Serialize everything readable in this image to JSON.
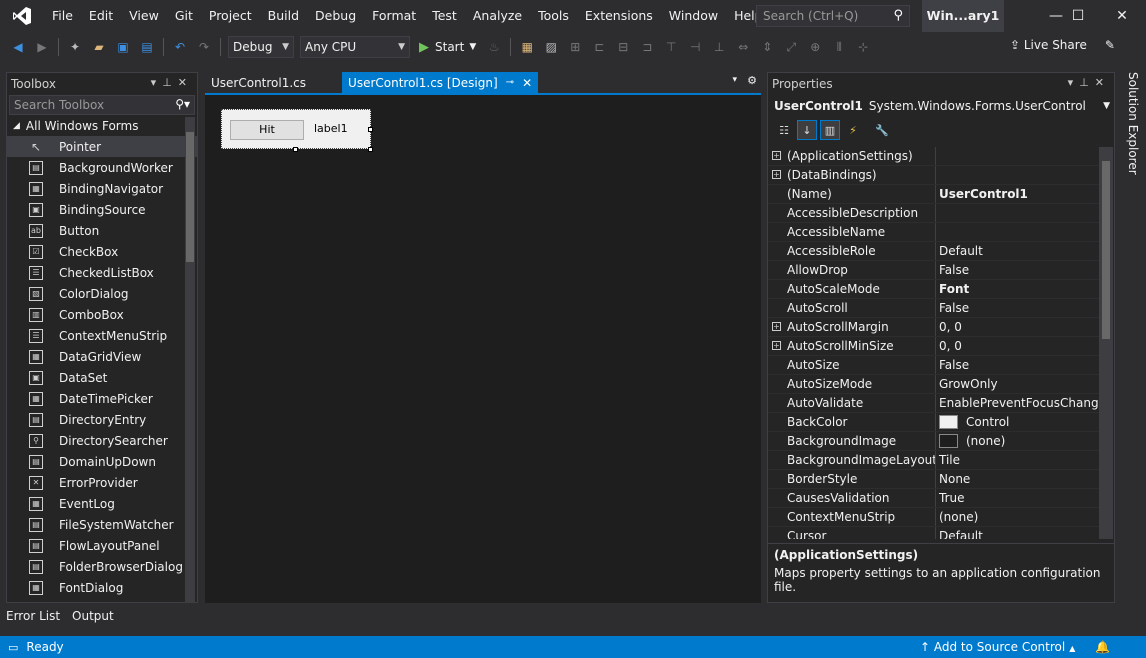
{
  "menubar": {
    "items": [
      "File",
      "Edit",
      "View",
      "Git",
      "Project",
      "Build",
      "Debug",
      "Format",
      "Test",
      "Analyze",
      "Tools",
      "Extensions",
      "Window",
      "Help"
    ],
    "search_placeholder": "Search (Ctrl+Q)",
    "window_title": "Win...ary1"
  },
  "toolbar": {
    "config": "Debug",
    "platform": "Any CPU",
    "start": "Start",
    "live_share": "Live Share"
  },
  "toolbox": {
    "title": "Toolbox",
    "search_placeholder": "Search Toolbox",
    "group": "All Windows Forms",
    "items": [
      "Pointer",
      "BackgroundWorker",
      "BindingNavigator",
      "BindingSource",
      "Button",
      "CheckBox",
      "CheckedListBox",
      "ColorDialog",
      "ComboBox",
      "ContextMenuStrip",
      "DataGridView",
      "DataSet",
      "DateTimePicker",
      "DirectoryEntry",
      "DirectorySearcher",
      "DomainUpDown",
      "ErrorProvider",
      "EventLog",
      "FileSystemWatcher",
      "FlowLayoutPanel",
      "FolderBrowserDialog",
      "FontDialog"
    ]
  },
  "editor": {
    "tabs": [
      "UserControl1.cs",
      "UserControl1.cs [Design]"
    ],
    "design": {
      "button_text": "Hit",
      "label_text": "label1"
    }
  },
  "properties": {
    "title": "Properties",
    "object_name": "UserControl1",
    "object_type": "System.Windows.Forms.UserControl",
    "rows": [
      {
        "name": "(ApplicationSettings)",
        "value": "",
        "expandable": true
      },
      {
        "name": "(DataBindings)",
        "value": "",
        "expandable": true
      },
      {
        "name": "(Name)",
        "value": "UserControl1",
        "bold": true
      },
      {
        "name": "AccessibleDescription",
        "value": ""
      },
      {
        "name": "AccessibleName",
        "value": ""
      },
      {
        "name": "AccessibleRole",
        "value": "Default"
      },
      {
        "name": "AllowDrop",
        "value": "False"
      },
      {
        "name": "AutoScaleMode",
        "value": "Font",
        "bold": true
      },
      {
        "name": "AutoScroll",
        "value": "False"
      },
      {
        "name": "AutoScrollMargin",
        "value": "0, 0",
        "expandable": true
      },
      {
        "name": "AutoScrollMinSize",
        "value": "0, 0",
        "expandable": true
      },
      {
        "name": "AutoSize",
        "value": "False"
      },
      {
        "name": "AutoSizeMode",
        "value": "GrowOnly"
      },
      {
        "name": "AutoValidate",
        "value": "EnablePreventFocusChange"
      },
      {
        "name": "BackColor",
        "value": "Control",
        "swatch": "#f0f0f0"
      },
      {
        "name": "BackgroundImage",
        "value": "(none)",
        "swatch": "#1e1e1e"
      },
      {
        "name": "BackgroundImageLayout",
        "value": "Tile"
      },
      {
        "name": "BorderStyle",
        "value": "None"
      },
      {
        "name": "CausesValidation",
        "value": "True"
      },
      {
        "name": "ContextMenuStrip",
        "value": "(none)"
      },
      {
        "name": "Cursor",
        "value": "Default"
      }
    ],
    "desc_title": "(ApplicationSettings)",
    "desc_text": "Maps property settings to an application configuration file."
  },
  "side": {
    "solution_explorer": "Solution Explorer"
  },
  "bottom": {
    "tabs": [
      "Error List",
      "Output"
    ]
  },
  "status": {
    "ready": "Ready",
    "source_control": "Add to Source Control"
  }
}
